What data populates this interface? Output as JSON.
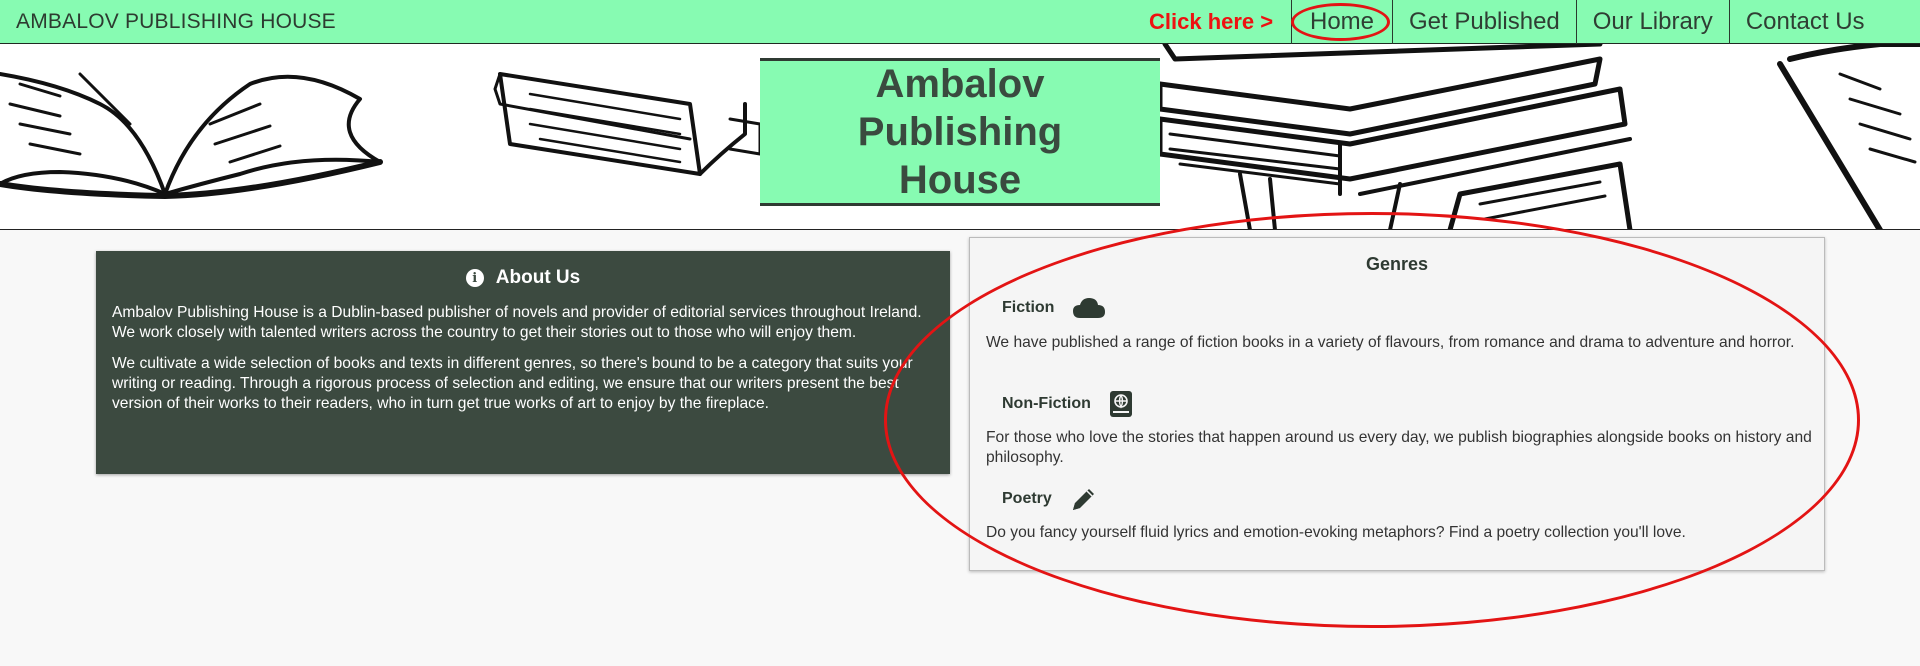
{
  "navbar": {
    "brand": "AMBALOV PUBLISHING HOUSE",
    "click_hint": "Click here >",
    "items": [
      {
        "label": "Home"
      },
      {
        "label": "Get Published"
      },
      {
        "label": "Our Library"
      },
      {
        "label": "Contact Us"
      }
    ]
  },
  "hero": {
    "title": "Ambalov Publishing House"
  },
  "about": {
    "icon": "info-circle-icon",
    "title": "About Us",
    "paragraphs": [
      "Ambalov Publishing House is a Dublin-based publisher of novels and provider of editorial services throughout Ireland. We work closely with talented writers across the country to get their stories out to those who will enjoy them.",
      "We cultivate a wide selection of books and texts in different genres, so there's bound to be a category that suits your writing or reading. Through a rigorous process of selection and editing, we ensure that our writers present the best version of their works to their readers, who in turn get true works of art to enjoy by the fireplace."
    ]
  },
  "genres": {
    "title": "Genres",
    "items": [
      {
        "name": "Fiction",
        "icon": "cloud-icon",
        "description": "We have published a range of fiction books in a variety of flavours, from romance and drama to adventure and horror."
      },
      {
        "name": "Non-Fiction",
        "icon": "atlas-book-icon",
        "description": "For those who love the stories that happen around us every day, we publish biographies alongside books on history and philosophy."
      },
      {
        "name": "Poetry",
        "icon": "pencil-icon",
        "description": "Do you fancy yourself fluid lyrics and emotion-evoking metaphors? Find a poetry collection you'll love."
      }
    ]
  },
  "colors": {
    "accent_green": "#87fbb2",
    "dark_panel": "#3c4a40",
    "annotation_red": "#e31414"
  }
}
